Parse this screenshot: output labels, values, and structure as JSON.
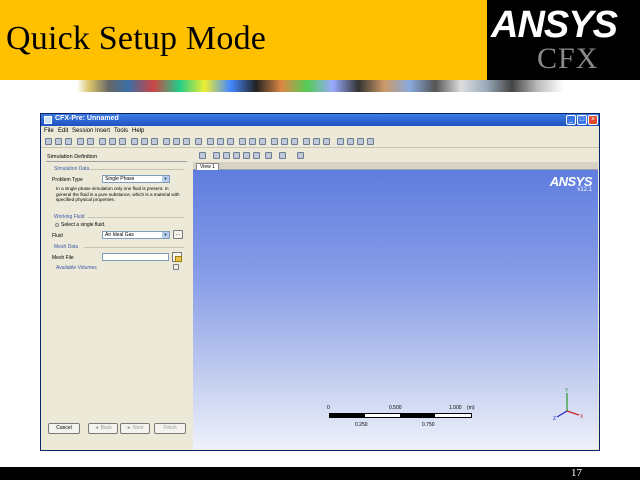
{
  "slide": {
    "title": "Quick Setup Mode",
    "logo_text_main": "ANSYS",
    "logo_text_sub": "CFX",
    "page_number": "17",
    "brand_color": "#ffc000"
  },
  "window": {
    "title": "CFX-Pre: Unnamed",
    "controls": [
      "_",
      "□",
      "×"
    ]
  },
  "menu": [
    "File",
    "Edit",
    "Session",
    "Insert",
    "Tools",
    "Help"
  ],
  "panel": {
    "title": "Simulation Definition",
    "simulation_data": {
      "section_label": "Simulation Data",
      "problem_type_label": "Problem Type",
      "problem_type_value": "Single Phase",
      "info_text_line1": "In a single phase simulation only one fluid is present. In",
      "info_text_line2": "general the fluid is a pure substance, which is a material with",
      "info_text_line3": "specified physical properties."
    },
    "working_fluid": {
      "section_label": "Working Fluid",
      "select_label": "Select a single fluid.",
      "fluid_label": "Fluid",
      "fluid_value": "Air Ideal Gas",
      "more_button": "..."
    },
    "mesh_data": {
      "section_label": "Mesh Data",
      "mesh_file_label": "Mesh File",
      "mesh_file_value": "",
      "available_volumes_label": "Available Volumes"
    },
    "buttons": {
      "cancel": "Cancel",
      "back": "Back",
      "next": "Next",
      "finish": "Finish"
    }
  },
  "viewer": {
    "tab_label": "View 1",
    "logo_main": "ANSYS",
    "version": "v12.1",
    "scale_labels_top": [
      "0",
      "0.500",
      "1.000",
      "(m)"
    ],
    "scale_labels_bottom": [
      "0.250",
      "0.750"
    ],
    "axis_labels": {
      "y": "Y",
      "x": "X",
      "z": "Z"
    }
  }
}
